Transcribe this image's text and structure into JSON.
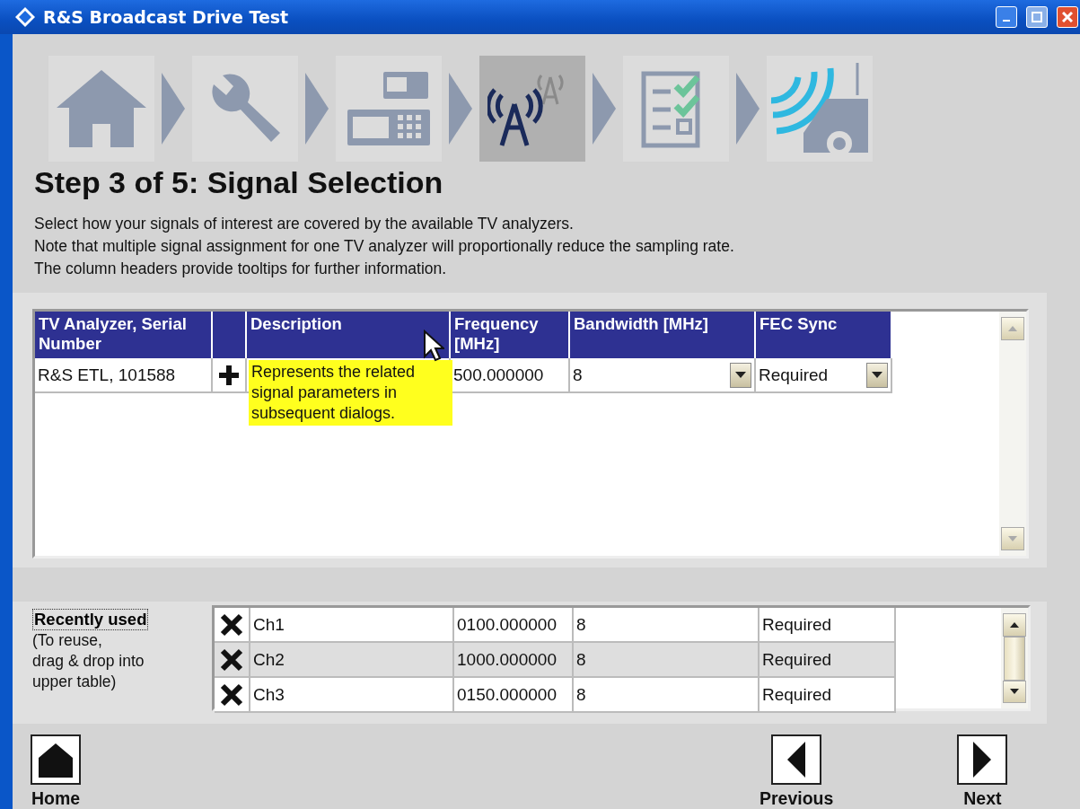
{
  "window": {
    "title": "R&S Broadcast Drive Test"
  },
  "steps": [
    {
      "kind": "home",
      "selected": false
    },
    {
      "kind": "setup",
      "selected": false
    },
    {
      "kind": "devices",
      "selected": false
    },
    {
      "kind": "signal",
      "selected": true
    },
    {
      "kind": "checklist",
      "selected": false
    },
    {
      "kind": "drive",
      "selected": false
    }
  ],
  "heading": "Step 3 of 5: Signal Selection",
  "intro": [
    "Select how your signals of interest are covered by the available TV analyzers.",
    "Note that multiple signal assignment for one TV analyzer will proportionally reduce the sampling rate.",
    "The column headers provide tooltips for further information."
  ],
  "signal_table": {
    "columns": [
      "TV Analyzer, Serial Number",
      "Description",
      "Frequency [MHz]",
      "Bandwidth [MHz]",
      "FEC Sync"
    ],
    "rows": [
      {
        "analyzer": "R&S ETL, 101588",
        "frequency": "500.000000",
        "bandwidth": "8",
        "fec_sync": "Required"
      }
    ],
    "tooltip": "Represents the related signal parameters in subsequent dialogs."
  },
  "recently_used": {
    "title": "Recently used",
    "hint": [
      "(To reuse,",
      "drag & drop  into",
      "upper table)"
    ],
    "rows": [
      {
        "name": "Ch1",
        "frequency": "0100.000000",
        "bandwidth": "8",
        "fec_sync": "Required"
      },
      {
        "name": "Ch2",
        "frequency": "1000.000000",
        "bandwidth": "8",
        "fec_sync": "Required"
      },
      {
        "name": "Ch3",
        "frequency": "0150.000000",
        "bandwidth": "8",
        "fec_sync": "Required"
      }
    ]
  },
  "nav": [
    {
      "kind": "home",
      "label": "Home"
    },
    {
      "kind": "previous",
      "label": "Previous"
    },
    {
      "kind": "next",
      "label": "Next"
    }
  ]
}
